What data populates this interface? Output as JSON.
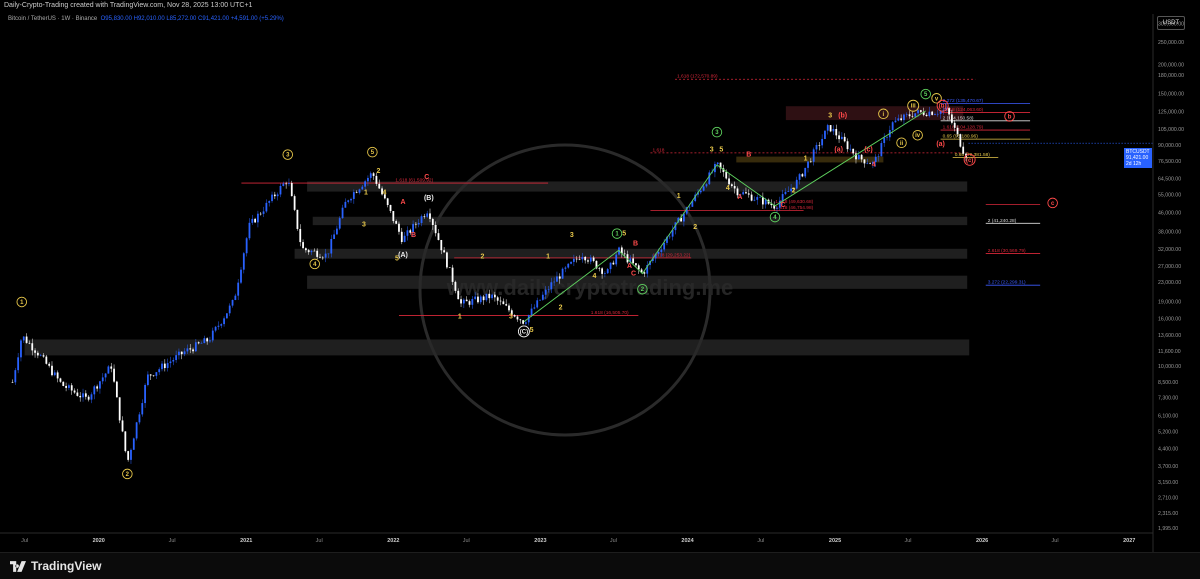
{
  "header": {
    "published": "Daily-Crypto-Trading created with TradingView.com, Nov 28, 2025 13:00 UTC+1",
    "symbol": "Bitcoin / TetherUS · 1W · Binance",
    "ohlc": {
      "o": "O95,830.00",
      "h": "H92,010.00",
      "l": "L85,272.00",
      "c": "C91,421.00",
      "chg": "+4,591.00 (+5.29%)"
    }
  },
  "price_scale": {
    "currency": "USDT",
    "ticks": [
      "300,000.00",
      "250,000.00",
      "200,000.00",
      "180,000.00",
      "150,000.00",
      "125,000.00",
      "105,000.00",
      "90,000.00",
      "76,500.00",
      "64,500.00",
      "55,000.00",
      "46,000.00",
      "38,000.00",
      "32,000.00",
      "27,000.00",
      "23,000.00",
      "19,000.00",
      "16,000.00",
      "13,600.00",
      "11,600.00",
      "10,000.00",
      "8,500.00",
      "7,300.00",
      "6,100.00",
      "5,200.00",
      "4,400.00",
      "3,700.00",
      "3,150.00",
      "2,710.00",
      "2,315.00",
      "1,995.00"
    ],
    "last_symbol": "BTCUSDT",
    "last_price": "91,421.00",
    "last_countdown": "2d 12h"
  },
  "time_scale": {
    "labels": [
      "Jul",
      "2020",
      "Jul",
      "2021",
      "Jul",
      "2022",
      "Jul",
      "2023",
      "Jul",
      "2024",
      "Jul",
      "2025",
      "Jul",
      "2026",
      "Jul",
      "2027"
    ]
  },
  "watermark": "www.dailycryptotrading.me",
  "footer": {
    "brand": "TradingView"
  },
  "colors": {
    "bull": "#2962ff",
    "bear": "#ffffff",
    "wave_yellow": "#e8c84a",
    "wave_red": "#ff4a4a",
    "wave_green": "#5fd35f",
    "fib_red": "#d9283a",
    "fib_blue": "#3d5cff",
    "zone": "#2a2a2a"
  },
  "chart_data": {
    "type": "candlestick",
    "scale": "log",
    "ylim": [
      1900,
      330000
    ],
    "x_range": [
      "2019-05-01",
      "2027-03-01"
    ],
    "series_weekly_close_approx": [
      [
        "2019-06-01",
        8500
      ],
      [
        "2019-06-24",
        13500
      ],
      [
        "2019-08-01",
        11500
      ],
      [
        "2019-10-01",
        8300
      ],
      [
        "2019-12-01",
        7200
      ],
      [
        "2020-02-01",
        10000
      ],
      [
        "2020-03-12",
        3800
      ],
      [
        "2020-05-01",
        9000
      ],
      [
        "2020-08-01",
        11500
      ],
      [
        "2020-10-01",
        13000
      ],
      [
        "2020-12-01",
        19000
      ],
      [
        "2021-01-08",
        40000
      ],
      [
        "2021-04-14",
        64000
      ],
      [
        "2021-05-19",
        32000
      ],
      [
        "2021-07-20",
        30000
      ],
      [
        "2021-09-07",
        52000
      ],
      [
        "2021-11-10",
        68000
      ],
      [
        "2022-01-24",
        35000
      ],
      [
        "2022-03-28",
        47500
      ],
      [
        "2022-06-18",
        18500
      ],
      [
        "2022-09-01",
        20000
      ],
      [
        "2022-11-21",
        15500
      ],
      [
        "2023-02-01",
        23000
      ],
      [
        "2023-04-14",
        30500
      ],
      [
        "2023-06-15",
        25000
      ],
      [
        "2023-07-14",
        31500
      ],
      [
        "2023-09-11",
        25000
      ],
      [
        "2023-12-01",
        40000
      ],
      [
        "2024-03-14",
        73700
      ],
      [
        "2024-05-01",
        57000
      ],
      [
        "2024-08-05",
        49000
      ],
      [
        "2024-10-01",
        63000
      ],
      [
        "2024-12-17",
        108000
      ],
      [
        "2025-02-28",
        79000
      ],
      [
        "2025-04-07",
        74500
      ],
      [
        "2025-05-22",
        111000
      ],
      [
        "2025-07-14",
        123000
      ],
      [
        "2025-08-14",
        124500
      ],
      [
        "2025-10-06",
        126200
      ],
      [
        "2025-11-21",
        80500
      ],
      [
        "2025-11-28",
        91421
      ]
    ],
    "fib_levels": [
      {
        "label": "1.618 (61,509.92)",
        "value": 61509.92,
        "color": "red"
      },
      {
        "label": "1.618 (46,754.98)",
        "value": 46754.98,
        "color": "red"
      },
      {
        "label": "1.618 (29,253.22)",
        "value": 29253.22,
        "color": "red"
      },
      {
        "label": "1.618 (16,505.70)",
        "value": 16505.7,
        "color": "red"
      },
      {
        "label": "1.618 (172,570.89)",
        "value": 172570.89,
        "color": "red"
      },
      {
        "label": "2.272 (135,470.67)",
        "value": 135470.67,
        "color": "blue"
      },
      {
        "label": "2.618 (124,063.60)",
        "value": 124063.6,
        "color": "red"
      },
      {
        "label": "2 (114,150.58)",
        "value": 114150.58,
        "color": "white"
      },
      {
        "label": "1.618 (104,128.79)",
        "value": 104128.79,
        "color": "red"
      },
      {
        "label": "0.65 (95,180.96)",
        "value": 95180.96,
        "color": "yellow"
      },
      {
        "label": "1.618",
        "value": 83000,
        "color": "red"
      },
      {
        "label": "0.65 (79,381.58)",
        "value": 79381.58,
        "color": "yellow"
      },
      {
        "label": "1.618 (49,630.68)",
        "value": 49630.68,
        "color": "red"
      },
      {
        "label": "2 (41,240.28)",
        "value": 41240.28,
        "color": "white"
      },
      {
        "label": "2.618 (30,569.79)",
        "value": 30569.79,
        "color": "red"
      },
      {
        "label": "3.272 (22,299.31)",
        "value": 22299.31,
        "color": "blue"
      }
    ],
    "wave_labels": [
      {
        "t": "1",
        "d": "2019-06-24",
        "v": 18500,
        "c": "yellow",
        "circle": true
      },
      {
        "t": "2",
        "d": "2020-03-12",
        "v": 3350,
        "c": "yellow",
        "circle": true
      },
      {
        "t": "3",
        "d": "2021-04-14",
        "v": 80000,
        "c": "yellow",
        "circle": true
      },
      {
        "t": "4",
        "d": "2021-06-20",
        "v": 27000,
        "c": "yellow",
        "circle": true
      },
      {
        "t": "5",
        "d": "2021-11-10",
        "v": 82000,
        "c": "yellow",
        "circle": true
      },
      {
        "t": "2",
        "d": "2021-11-25",
        "v": 68000,
        "c": "yellow"
      },
      {
        "t": "1",
        "d": "2021-10-25",
        "v": 55000,
        "c": "yellow"
      },
      {
        "t": "4",
        "d": "2021-12-10",
        "v": 55000,
        "c": "yellow"
      },
      {
        "t": "3",
        "d": "2021-10-20",
        "v": 40000,
        "c": "yellow"
      },
      {
        "t": "5",
        "d": "2022-01-10",
        "v": 28500,
        "c": "yellow"
      },
      {
        "t": "A",
        "d": "2022-01-25",
        "v": 50000,
        "c": "red"
      },
      {
        "t": "C",
        "d": "2022-03-25",
        "v": 64000,
        "c": "red"
      },
      {
        "t": "(B)",
        "d": "2022-03-30",
        "v": 52000,
        "c": "white"
      },
      {
        "t": "B",
        "d": "2022-02-20",
        "v": 36000,
        "c": "red"
      },
      {
        "t": "(A)",
        "d": "2022-01-25",
        "v": 29500,
        "c": "white"
      },
      {
        "t": "2",
        "d": "2022-08-10",
        "v": 29000,
        "c": "yellow"
      },
      {
        "t": "1",
        "d": "2022-06-15",
        "v": 16000,
        "c": "yellow"
      },
      {
        "t": "3",
        "d": "2022-10-20",
        "v": 16000,
        "c": "yellow"
      },
      {
        "t": "(C)",
        "d": "2022-11-21",
        "v": 13800,
        "c": "white",
        "circle": true
      },
      {
        "t": "5",
        "d": "2022-12-10",
        "v": 14000,
        "c": "yellow"
      },
      {
        "t": "2",
        "d": "2023-02-20",
        "v": 17500,
        "c": "yellow"
      },
      {
        "t": "1",
        "d": "2023-01-20",
        "v": 29000,
        "c": "yellow"
      },
      {
        "t": "3",
        "d": "2023-03-20",
        "v": 36000,
        "c": "yellow"
      },
      {
        "t": "4",
        "d": "2023-05-15",
        "v": 24000,
        "c": "yellow"
      },
      {
        "t": "1",
        "d": "2023-07-10",
        "v": 36500,
        "c": "green",
        "circle": true
      },
      {
        "t": "5",
        "d": "2023-07-28",
        "v": 36500,
        "c": "yellow"
      },
      {
        "t": "B",
        "d": "2023-08-25",
        "v": 33000,
        "c": "red"
      },
      {
        "t": "A",
        "d": "2023-08-10",
        "v": 26500,
        "c": "red"
      },
      {
        "t": "C",
        "d": "2023-08-20",
        "v": 24500,
        "c": "red"
      },
      {
        "t": "2",
        "d": "2023-09-11",
        "v": 21000,
        "c": "green",
        "circle": true
      },
      {
        "t": "1",
        "d": "2023-12-10",
        "v": 53000,
        "c": "yellow"
      },
      {
        "t": "2",
        "d": "2024-01-20",
        "v": 39000,
        "c": "yellow"
      },
      {
        "t": "3",
        "d": "2024-03-01",
        "v": 84000,
        "c": "yellow"
      },
      {
        "t": "3",
        "d": "2024-03-14",
        "v": 100000,
        "c": "green",
        "circle": true
      },
      {
        "t": "5",
        "d": "2024-03-25",
        "v": 84000,
        "c": "yellow"
      },
      {
        "t": "4",
        "d": "2024-04-10",
        "v": 57500,
        "c": "yellow"
      },
      {
        "t": "A",
        "d": "2024-05-10",
        "v": 52500,
        "c": "red"
      },
      {
        "t": "B",
        "d": "2024-06-01",
        "v": 80000,
        "c": "red"
      },
      {
        "t": "C",
        "d": "2024-08-25",
        "v": 48500,
        "c": "red"
      },
      {
        "t": "4",
        "d": "2024-08-05",
        "v": 43000,
        "c": "green",
        "circle": true
      },
      {
        "t": "2",
        "d": "2024-09-20",
        "v": 56000,
        "c": "yellow"
      },
      {
        "t": "1",
        "d": "2024-10-20",
        "v": 77000,
        "c": "yellow"
      },
      {
        "t": "3",
        "d": "2024-12-20",
        "v": 118000,
        "c": "yellow"
      },
      {
        "t": "(b)",
        "d": "2025-01-20",
        "v": 118000,
        "c": "red"
      },
      {
        "t": "(a)",
        "d": "2025-01-10",
        "v": 84000,
        "c": "red"
      },
      {
        "t": "(c)",
        "d": "2025-03-25",
        "v": 84000,
        "c": "red"
      },
      {
        "t": "4",
        "d": "2025-04-07",
        "v": 72500,
        "c": "red"
      },
      {
        "t": "i",
        "d": "2025-05-01",
        "v": 120000,
        "c": "yellow",
        "circle": true
      },
      {
        "t": "ii",
        "d": "2025-06-15",
        "v": 90000,
        "c": "yellow",
        "circle": true
      },
      {
        "t": "iii",
        "d": "2025-07-14",
        "v": 130000,
        "c": "yellow",
        "circle": true
      },
      {
        "t": "iv",
        "d": "2025-07-25",
        "v": 97000,
        "c": "yellow",
        "circle": true
      },
      {
        "t": "5",
        "d": "2025-08-14",
        "v": 146000,
        "c": "green",
        "circle": true
      },
      {
        "t": "v",
        "d": "2025-09-10",
        "v": 140000,
        "c": "yellow",
        "circle": true
      },
      {
        "t": "(b)",
        "d": "2025-09-25",
        "v": 130000,
        "c": "red",
        "circle": true
      },
      {
        "t": "(a)",
        "d": "2025-09-20",
        "v": 89000,
        "c": "red"
      },
      {
        "t": "(c)",
        "d": "2025-12-01",
        "v": 76000,
        "c": "red",
        "circle": true
      },
      {
        "t": "b",
        "d": "2026-03-10",
        "v": 117000,
        "c": "red",
        "circle": true
      },
      {
        "t": "c",
        "d": "2026-06-25",
        "v": 49500,
        "c": "red",
        "circle": true
      }
    ]
  }
}
